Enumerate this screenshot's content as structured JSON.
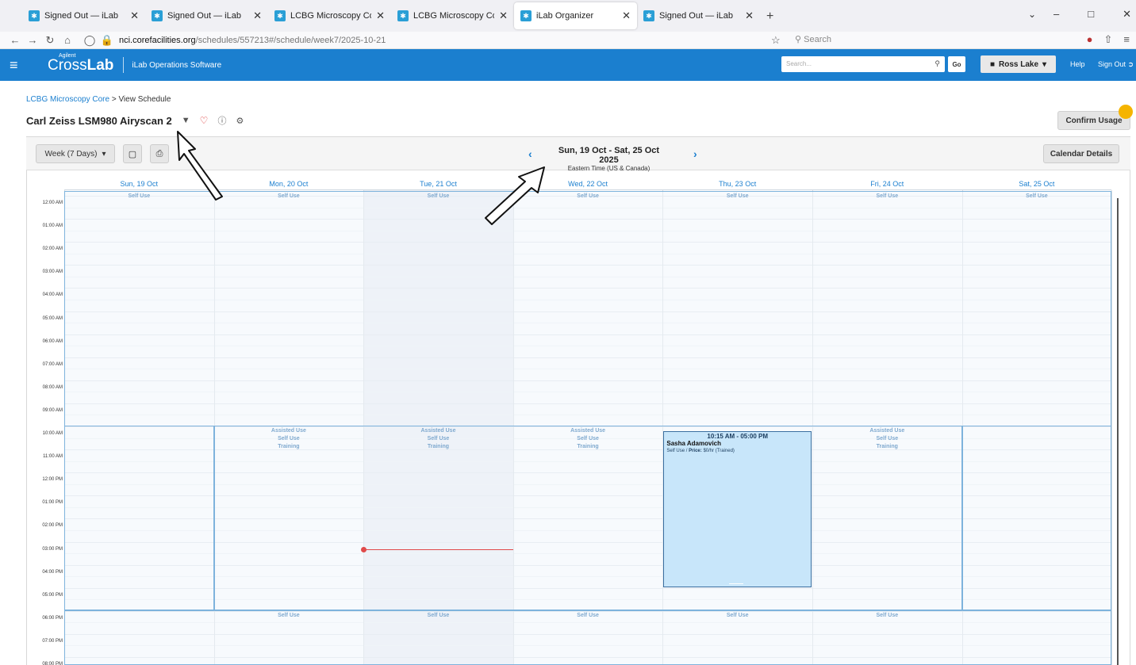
{
  "browser": {
    "tabs": [
      {
        "label": "Signed Out — iLab",
        "active": false
      },
      {
        "label": "Signed Out — iLab",
        "active": false
      },
      {
        "label": "LCBG Microscopy Core",
        "active": false
      },
      {
        "label": "LCBG Microscopy Core",
        "active": false
      },
      {
        "label": "iLab Organizer",
        "active": true
      },
      {
        "label": "Signed Out — iLab",
        "active": false
      }
    ],
    "new_tab": "+",
    "url_domain": "nci.corefacilities.org",
    "url_path": "/schedules/557213#/schedule/week7/2025-10-21",
    "search_placeholder": "Search"
  },
  "header": {
    "logo_sup": "Agilent",
    "logo_light": "Cross",
    "logo_bold": "Lab",
    "subtitle": "iLab Operations Software",
    "search_placeholder": "Search...",
    "go_label": "Go",
    "user_label": "Ross Lake",
    "help_label": "Help",
    "signout_label": "Sign Out"
  },
  "breadcrumb": {
    "core": "LCBG Microscopy Core",
    "sep": ">",
    "current": "View Schedule"
  },
  "instrument": {
    "name": "Carl Zeiss LSM980 Airyscan 2"
  },
  "confirm_label": "Confirm Usage",
  "toolbar": {
    "view_label": "Week (7 Days)",
    "range_label": "Sun, 19 Oct - Sat, 25 Oct 2025",
    "timezone": "Eastern Time (US & Canada)",
    "calendar_details_label": "Calendar Details"
  },
  "days": [
    "Sun, 19 Oct",
    "Mon, 20 Oct",
    "Tue, 21 Oct",
    "Wed, 22 Oct",
    "Thu, 23 Oct",
    "Fri, 24 Oct",
    "Sat, 25 Oct"
  ],
  "times": [
    "12:00 AM",
    "01:00 AM",
    "02:00 AM",
    "03:00 AM",
    "04:00 AM",
    "05:00 AM",
    "06:00 AM",
    "07:00 AM",
    "08:00 AM",
    "09:00 AM",
    "10:00 AM",
    "11:00 AM",
    "12:00 PM",
    "01:00 PM",
    "02:00 PM",
    "03:00 PM",
    "04:00 PM",
    "05:00 PM",
    "06:00 PM",
    "07:00 PM",
    "08:00 PM"
  ],
  "availability": {
    "self_use": "Self Use",
    "weekday_block_lines": [
      "Assisted Use",
      "Self Use",
      "Training"
    ],
    "weekday_block_days": [
      1,
      2,
      3,
      4,
      5
    ],
    "evening_self_use_days": [
      1,
      2,
      3,
      4,
      5
    ]
  },
  "booking": {
    "time": "10:15 AM - 05:00 PM",
    "user": "Sasha Adamovich",
    "info_prefix": "Self Use / ",
    "price_label": "Price:",
    "price_value": "$0/hr (Trained)"
  },
  "now_marker": {
    "day_index": 2,
    "time": "03:20 PM"
  }
}
